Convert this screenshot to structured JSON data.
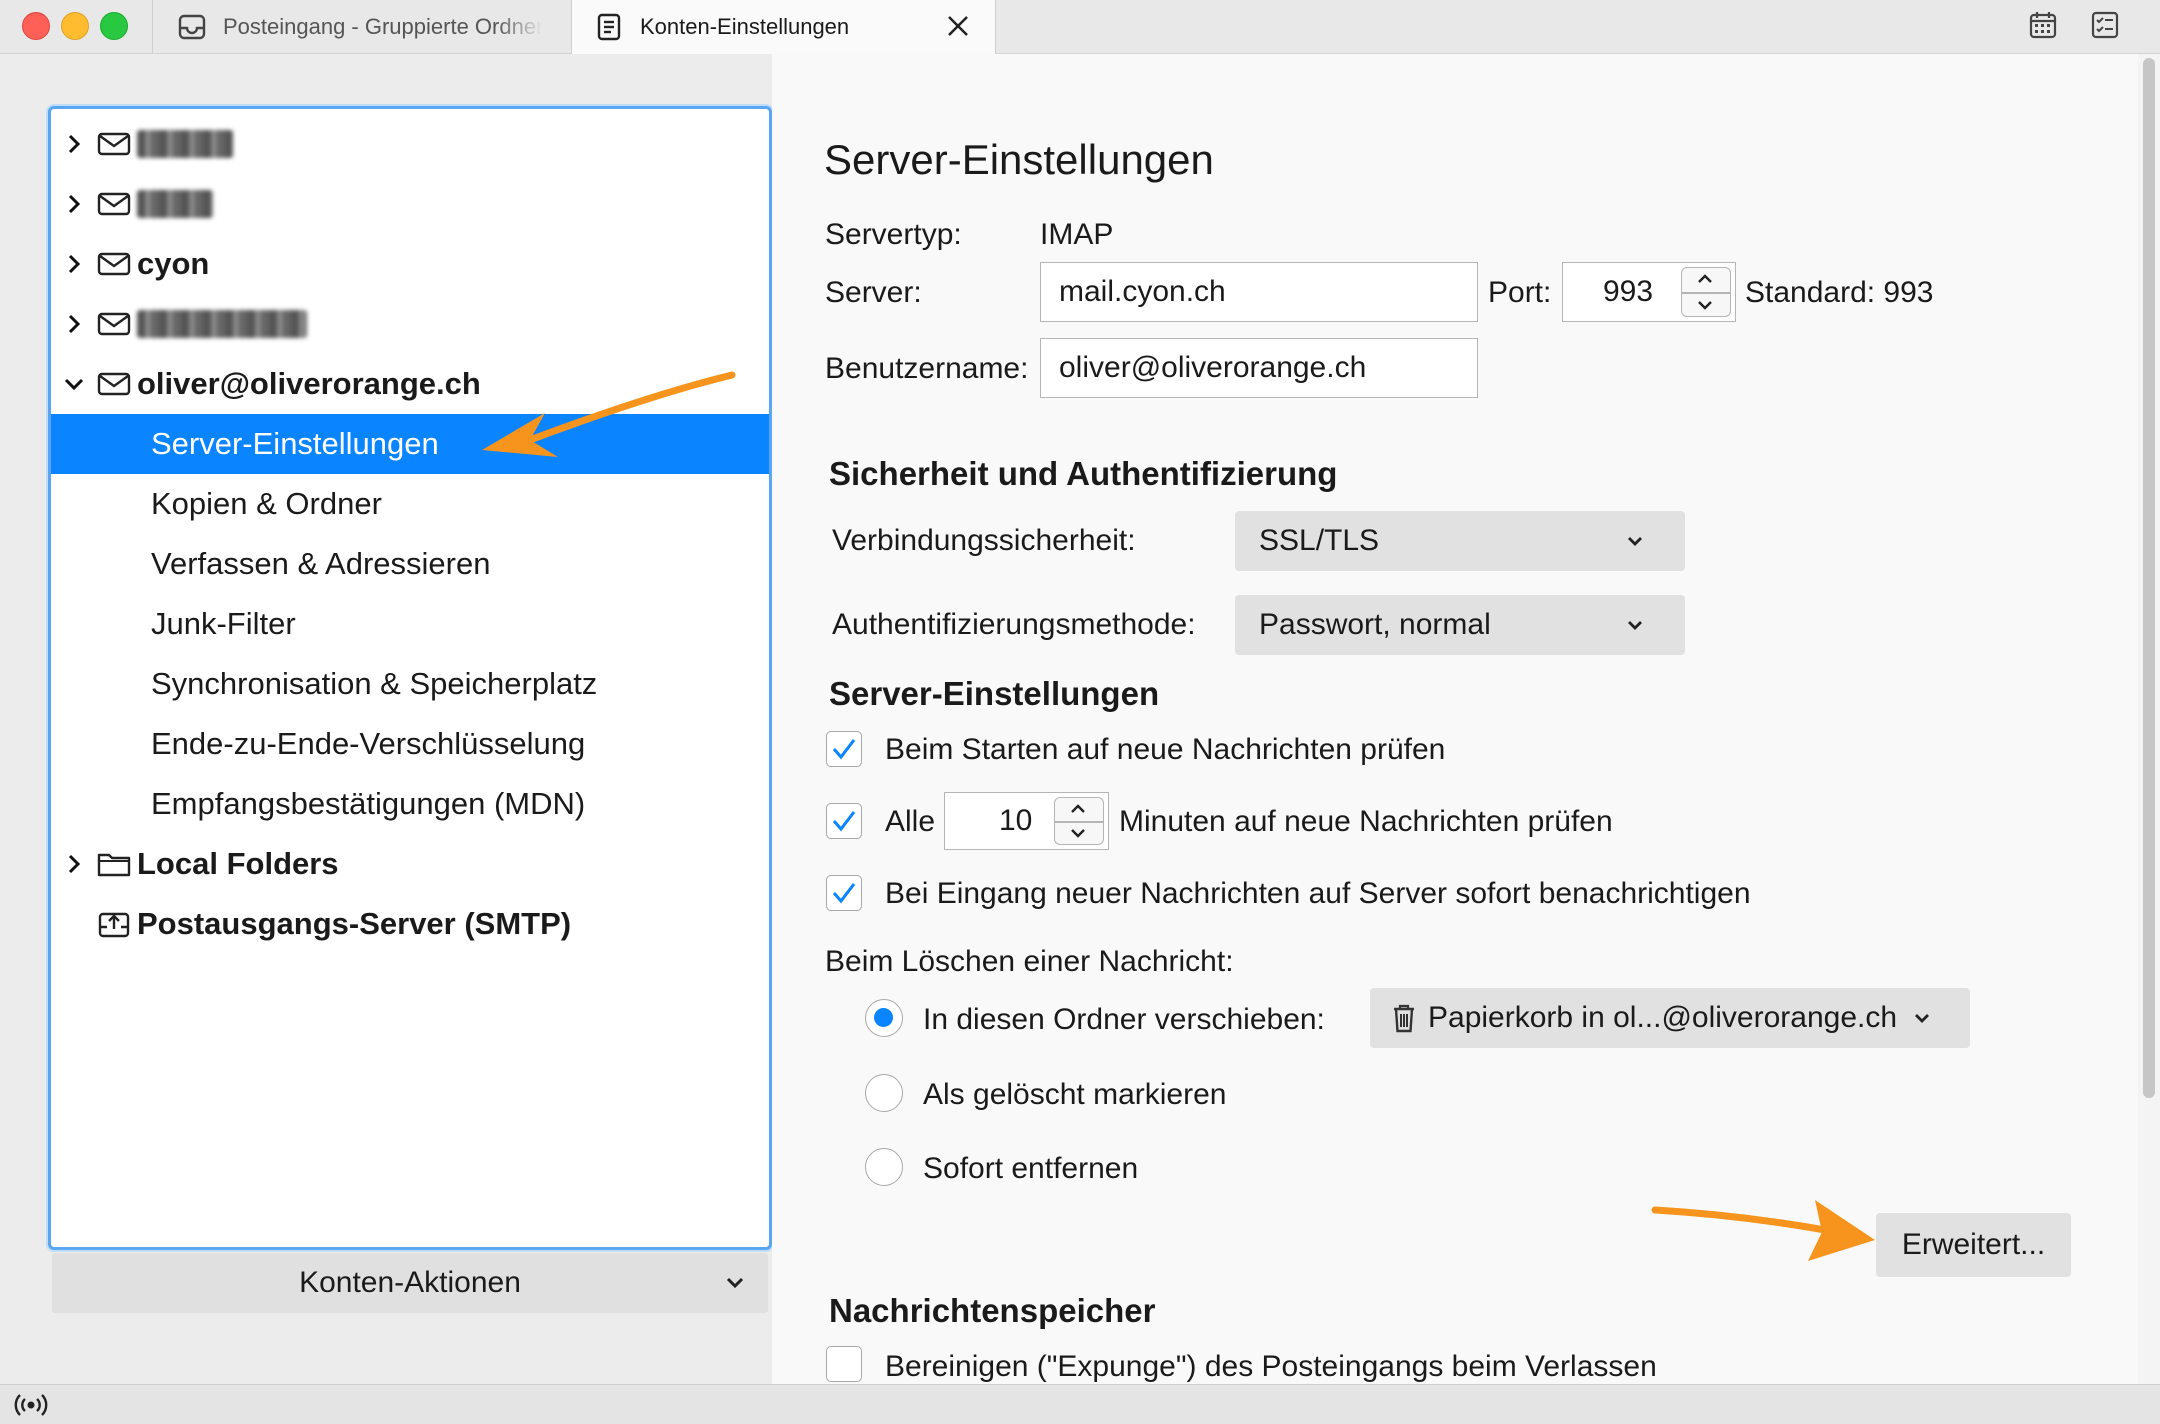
{
  "window": {
    "tabs": [
      {
        "label": "Posteingang - Gruppierte Ordner",
        "icon": "inbox-icon",
        "active": false
      },
      {
        "label": "Konten-Einstellungen",
        "icon": "document-icon",
        "active": true
      }
    ],
    "toolbar_icons": [
      "calendar-icon",
      "tasks-icon"
    ]
  },
  "sidebar": {
    "accounts": [
      {
        "label": "",
        "blurred": true,
        "expanded": false
      },
      {
        "label": "",
        "blurred": true,
        "expanded": false
      },
      {
        "label": "cyon",
        "blurred": false,
        "expanded": false
      },
      {
        "label": "",
        "blurred": true,
        "expanded": false
      },
      {
        "label": "oliver@oliverorange.ch",
        "blurred": false,
        "expanded": true
      }
    ],
    "account_pages": [
      "Server-Einstellungen",
      "Kopien & Ordner",
      "Verfassen & Adressieren",
      "Junk-Filter",
      "Synchronisation & Speicherplatz",
      "Ende-zu-Ende-Verschlüsselung",
      "Empfangsbestätigungen (MDN)"
    ],
    "selected_page": "Server-Einstellungen",
    "local_folders": "Local Folders",
    "smtp": "Postausgangs-Server (SMTP)",
    "actions_button": "Konten-Aktionen"
  },
  "server_settings": {
    "title": "Server-Einstellungen",
    "servertype_label": "Servertyp:",
    "servertype_value": "IMAP",
    "server_label": "Server:",
    "server_value": "mail.cyon.ch",
    "port_label": "Port:",
    "port_value": "993",
    "standard_label": "Standard: 993",
    "username_label": "Benutzername:",
    "username_value": "oliver@oliverorange.ch"
  },
  "security": {
    "heading": "Sicherheit und Authentifizierung",
    "connection_label": "Verbindungssicherheit:",
    "connection_value": "SSL/TLS",
    "auth_label": "Authentifizierungsmethode:",
    "auth_value": "Passwort, normal"
  },
  "server_options": {
    "heading": "Server-Einstellungen",
    "check_on_start": {
      "label": "Beim Starten auf neue Nachrichten prüfen",
      "checked": true
    },
    "check_every": {
      "prefix": "Alle",
      "minutes": "10",
      "suffix": "Minuten auf neue Nachrichten prüfen",
      "checked": true
    },
    "notify": {
      "label": "Bei Eingang neuer Nachrichten auf Server sofort benachrichtigen",
      "checked": true
    },
    "delete_label": "Beim Löschen einer Nachricht:",
    "delete_options": [
      {
        "label": "In diesen Ordner verschieben:",
        "selected": true
      },
      {
        "label": "Als gelöscht markieren",
        "selected": false
      },
      {
        "label": "Sofort entfernen",
        "selected": false
      }
    ],
    "trash_folder": "Papierkorb in ol...@oliverorange.ch",
    "advanced_button": "Erweitert..."
  },
  "storage": {
    "heading": "Nachrichtenspeicher",
    "expunge": {
      "label": "Bereinigen (\"Expunge\") des Posteingangs beim Verlassen",
      "checked": false
    }
  },
  "colors": {
    "selection": "#0a84ff",
    "focus_ring": "#5aa6f2",
    "annotation_arrow": "#f7941d"
  }
}
